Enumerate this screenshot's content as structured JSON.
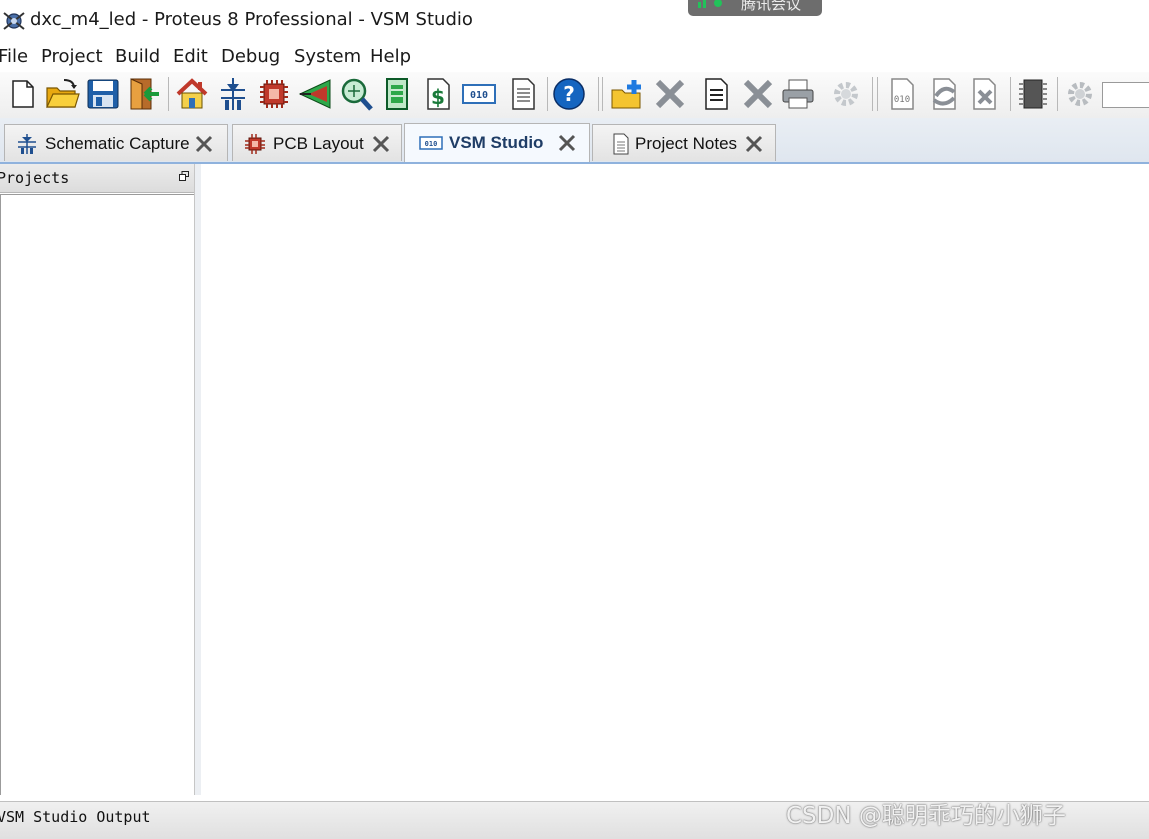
{
  "window": {
    "title": "dxc_m4_led - Proteus 8 Professional - VSM Studio",
    "app_icon": "proteus-app-icon"
  },
  "overlay": {
    "text": "腾讯会议",
    "icon": "signal-bars-icon"
  },
  "menu": [
    "File",
    "Project",
    "Build",
    "Edit",
    "Debug",
    "System",
    "Help"
  ],
  "toolbar": {
    "icons": [
      "new-project-icon",
      "open-project-icon",
      "save-project-icon",
      "close-project-icon",
      "home-page-icon",
      "schematic-capture-icon",
      "pcb-layout-icon",
      "3d-visualizer-icon",
      "gerber-viewer-icon",
      "design-explorer-icon",
      "bill-of-materials-icon",
      "vsm-studio-icon",
      "project-notes-icon",
      "help-icon",
      "add-file-icon",
      "remove-icon",
      "new-text-icon",
      "delete-icon",
      "print-icon",
      "settings-disabled-icon",
      "binary-file-icon",
      "rebuild-icon",
      "clean-icon",
      "chip-icon",
      "settings-icon"
    ]
  },
  "tabs": [
    {
      "label": "Schematic Capture",
      "icon": "schematic-icon"
    },
    {
      "label": "PCB Layout",
      "icon": "pcb-chip-icon"
    },
    {
      "label": "VSM Studio",
      "icon": "vsm-binary-icon",
      "active": true
    },
    {
      "label": "Project Notes",
      "icon": "notes-icon"
    }
  ],
  "projects_panel": {
    "title": "Projects"
  },
  "output_panel": {
    "title": "VSM Studio Output"
  },
  "watermark": "CSDN @聪明乖巧的小狮子",
  "colors": {
    "accent": "#8fb2dd",
    "active_tab_text": "#1f3d66",
    "help_blue": "#1565c0"
  }
}
